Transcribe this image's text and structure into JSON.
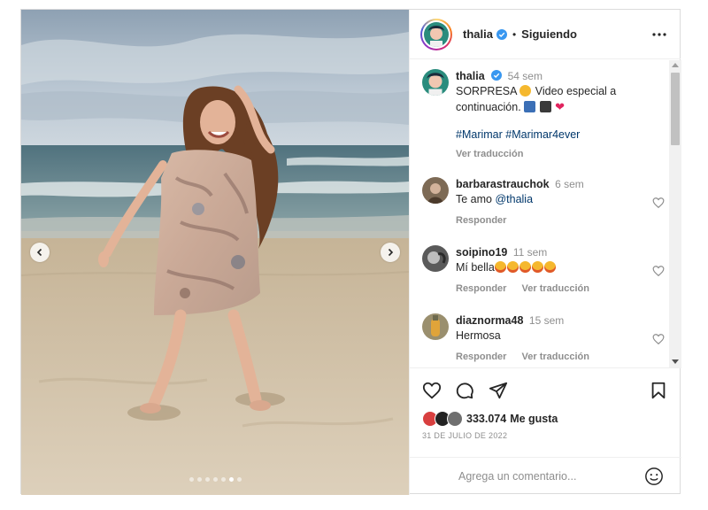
{
  "post": {
    "username": "thalia",
    "follow_status": "Siguiendo",
    "bullet": "•",
    "verified_icon": "verified-badge-icon",
    "more_icon": "more-options-icon",
    "carousel": {
      "total_slides": 7,
      "active_slide": 6
    }
  },
  "caption": {
    "username": "thalia",
    "time": "54 sem",
    "text_before": "SORPRESA",
    "text_after": "Video especial a continuación.",
    "emojis": [
      "star-struck-emoji",
      "newspaper-emoji",
      "clapper-board-emoji",
      "red-heart-emoji"
    ],
    "hashtags": [
      "#Marimar",
      "#Marimar4ever"
    ],
    "translate": "Ver traducción"
  },
  "comments": [
    {
      "username": "barbarastrauchok",
      "time": "6 sem",
      "text_prefix": "Te amo ",
      "mention": "@thalia",
      "reply": "Responder",
      "translate": ""
    },
    {
      "username": "soipino19",
      "time": "11 sem",
      "text_prefix": "Mí bella",
      "mention": "",
      "emoji_count": 5,
      "reply": "Responder",
      "translate": "Ver traducción"
    },
    {
      "username": "diaznorma48",
      "time": "15 sem",
      "text_prefix": "Hermosa",
      "mention": "",
      "reply": "Responder",
      "translate": "Ver traducción"
    }
  ],
  "footer": {
    "likes_count": "333.074",
    "likes_label": "Me gusta",
    "date": "31 DE JULIO DE 2022",
    "comment_placeholder": "Agrega un comentario...",
    "icons": [
      "heart-icon",
      "comment-icon",
      "share-icon",
      "bookmark-icon",
      "emoji-icon"
    ]
  },
  "colors": {
    "link": "#00376b",
    "muted": "#8e8e8e",
    "text": "#262626",
    "verified": "#3897f0"
  }
}
